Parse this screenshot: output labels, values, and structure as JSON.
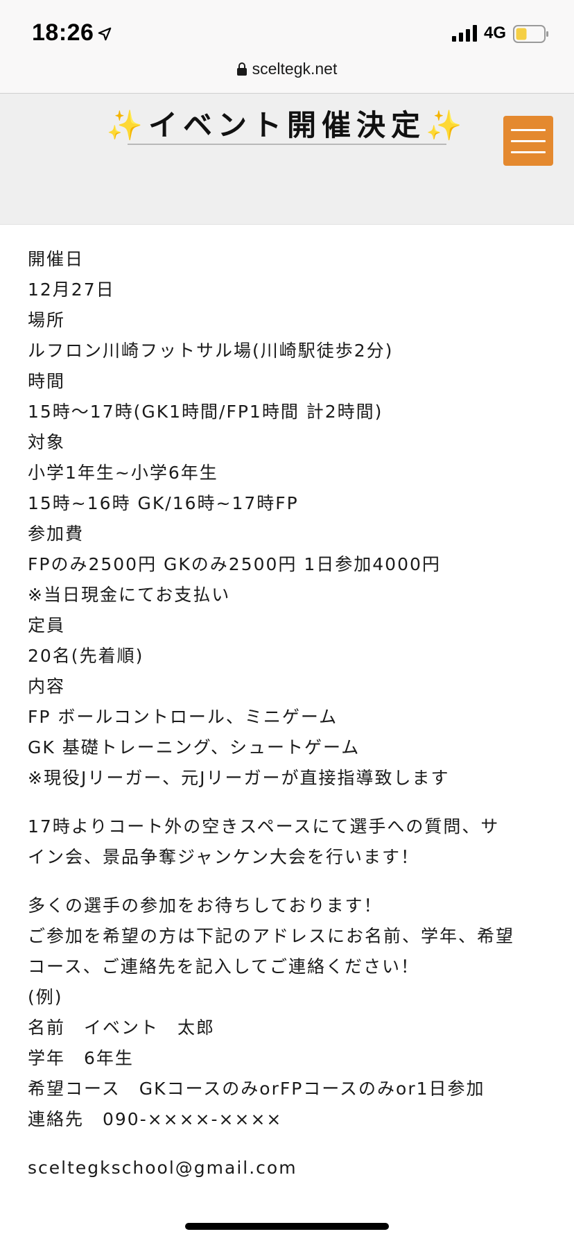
{
  "status_bar": {
    "time": "18:26",
    "network": "4G",
    "icons": [
      "location-arrow-icon",
      "signal-icon",
      "battery-icon"
    ]
  },
  "browser": {
    "url": "sceltegk.net",
    "lock_icon": "lock-icon"
  },
  "header": {
    "title": "✨イベント開催決定✨",
    "menu_icon": "hamburger-menu-icon",
    "menu_color": "#e4892f"
  },
  "details": [
    "開催日",
    "12月27日",
    "場所",
    "ルフロン川崎フットサル場(川崎駅徒歩2分)",
    "時間",
    "15時〜17時(GK1時間/FP1時間 計2時間)",
    "対象",
    "小学1年生~小学6年生",
    "15時~16時 GK/16時~17時FP",
    "参加費",
    "FPのみ2500円 GKのみ2500円 1日参加4000円",
    "※当日現金にてお支払い",
    "定員",
    "20名(先着順)",
    "内容",
    "FP ボールコントロール、ミニゲーム",
    "GK 基礎トレーニング、シュートゲーム",
    "※現役Jリーガー、元Jリーガーが直接指導致します"
  ],
  "after_event": {
    "line1": "17時よりコート外の空きスペースにて選手への質問、サ",
    "line2": "イン会、景品争奪ジャンケン大会を行います！"
  },
  "invitation": {
    "line1": "多くの選手の参加をお待ちしております！",
    "line2": "ご参加を希望の方は下記のアドレスにお名前、学年、希望",
    "line3": "コース、ご連絡先を記入してご連絡ください！",
    "example_label": "(例)",
    "example_name": "名前　イベント　太郎",
    "example_grade": "学年　6年生",
    "example_course": "希望コース　GKコースのみorFPコースのみor1日参加",
    "example_contact": "連絡先　090-××××-××××"
  },
  "contact_email": "sceltegkschool@gmail.com"
}
